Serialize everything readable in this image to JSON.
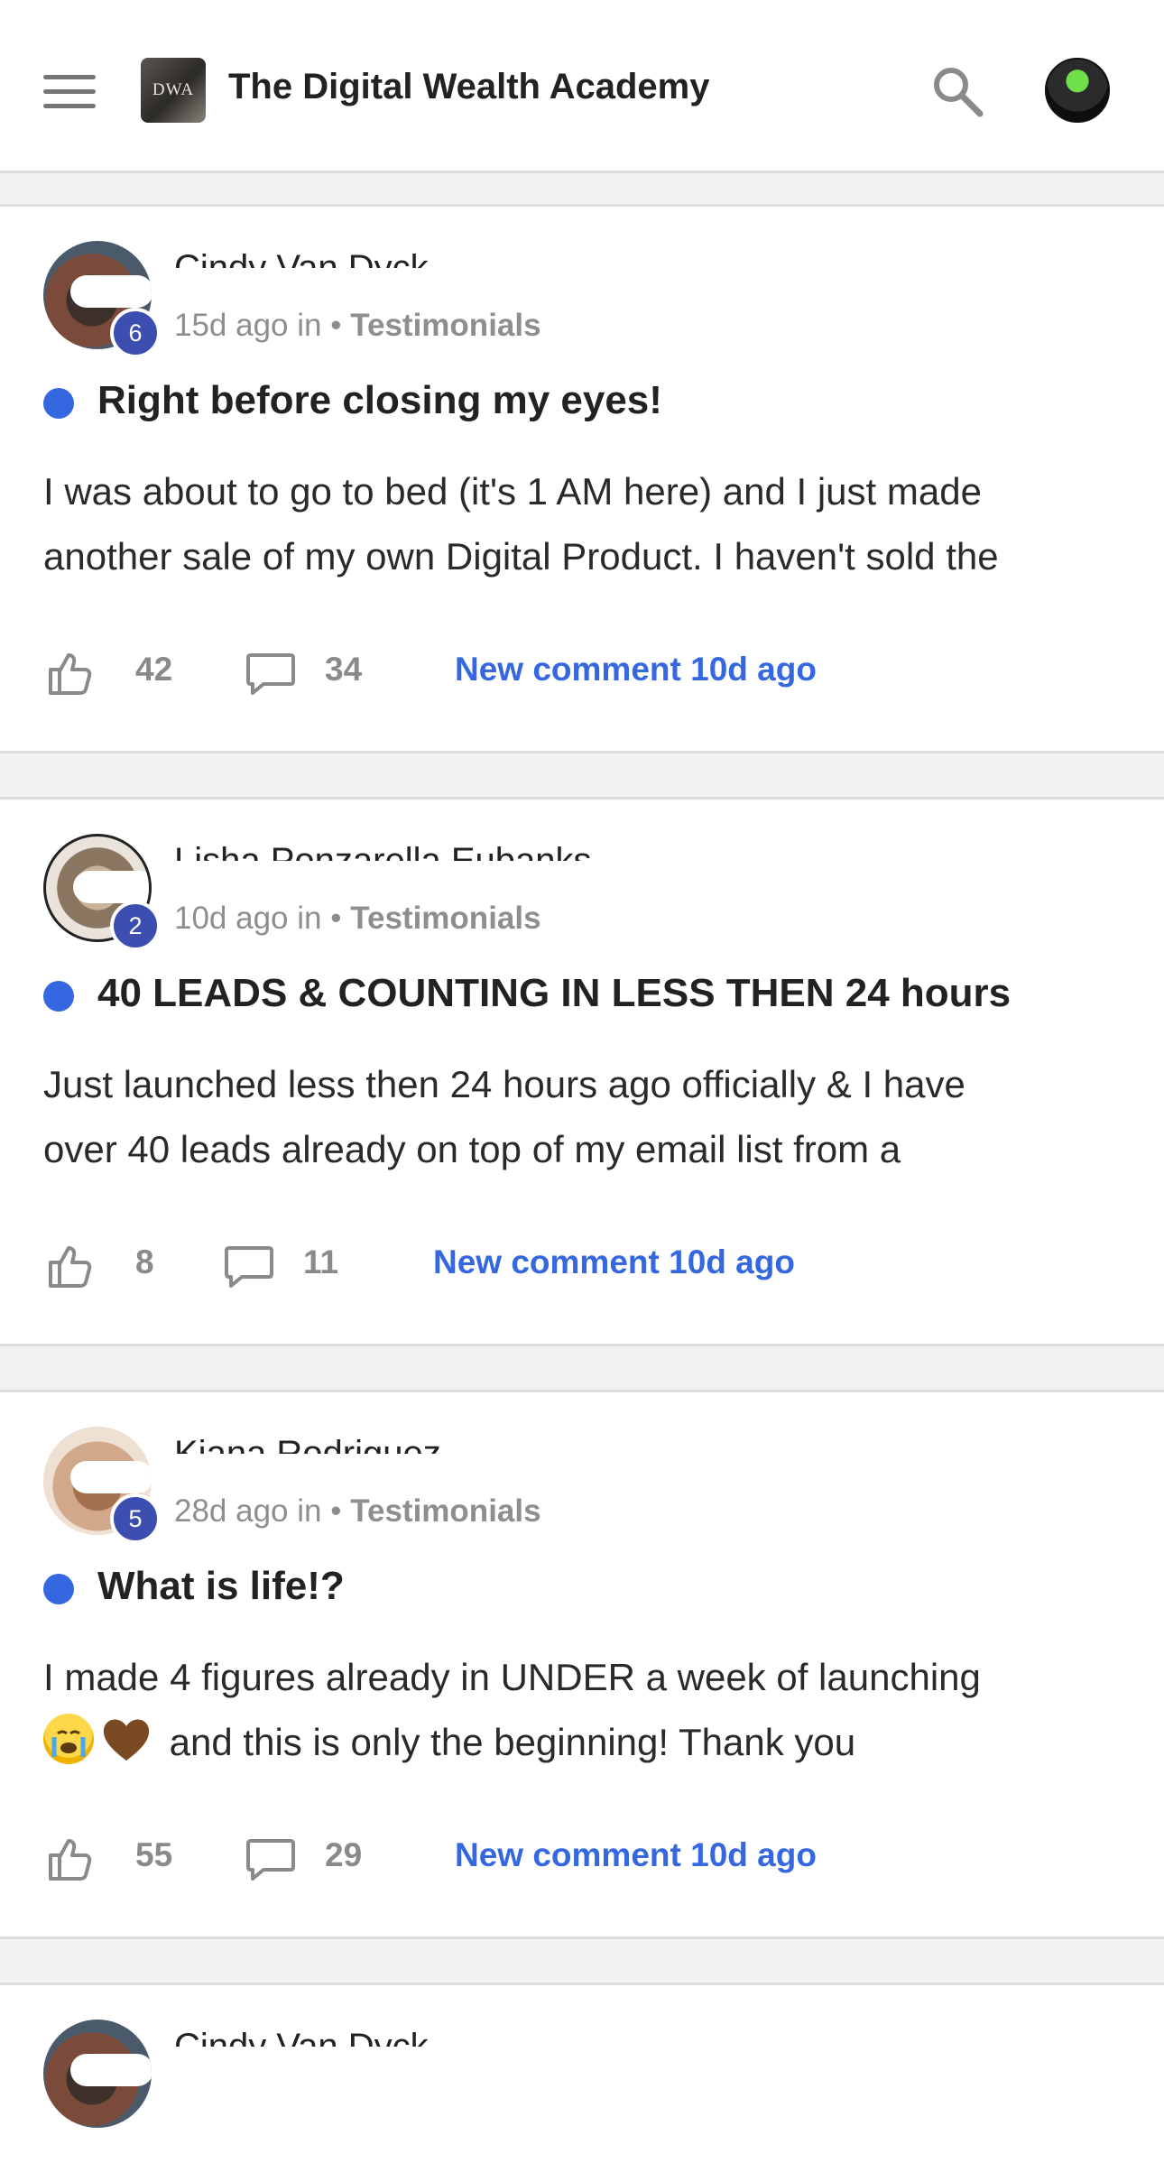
{
  "header": {
    "logo_text": "DWA",
    "title": "The Digital Wealth Academy"
  },
  "posts": [
    {
      "author": "Cindy Van Dyck",
      "level": "6",
      "time": "15d ago in",
      "separator": "•",
      "category": "Testimonials",
      "title": "Right before closing my eyes!",
      "body_line1": "I was about to go to bed (it's 1 AM here) and I just made",
      "body_line2": "another sale of my own Digital Product. I haven't sold the",
      "likes": "42",
      "comments": "34",
      "new_comment": "New comment 10d ago"
    },
    {
      "author": "Lisha Ponzarella Eubanks",
      "level": "2",
      "time": "10d ago in",
      "separator": "•",
      "category": "Testimonials",
      "title": "40 LEADS & COUNTING IN LESS THEN 24 hours",
      "body_line1": "Just launched less then 24 hours ago officially & I have",
      "body_line2": "over 40 leads already on top of my email list from a",
      "likes": "8",
      "comments": "11",
      "new_comment": "New comment 10d ago"
    },
    {
      "author": "Kiana Rodriguez",
      "level": "5",
      "time": "28d ago in",
      "separator": "•",
      "category": "Testimonials",
      "title": "What is life!?",
      "body_line1": "I made 4 figures already in UNDER a week of launching",
      "body_line2": "and this is only the beginning! Thank you",
      "likes": "55",
      "comments": "29",
      "new_comment": "New comment 10d ago"
    },
    {
      "author": "Cindy Van Dyck"
    }
  ],
  "colors": {
    "accent_blue": "#3568e0",
    "badge_blue": "#3c4fb0",
    "muted_gray": "#8e8e8e"
  }
}
